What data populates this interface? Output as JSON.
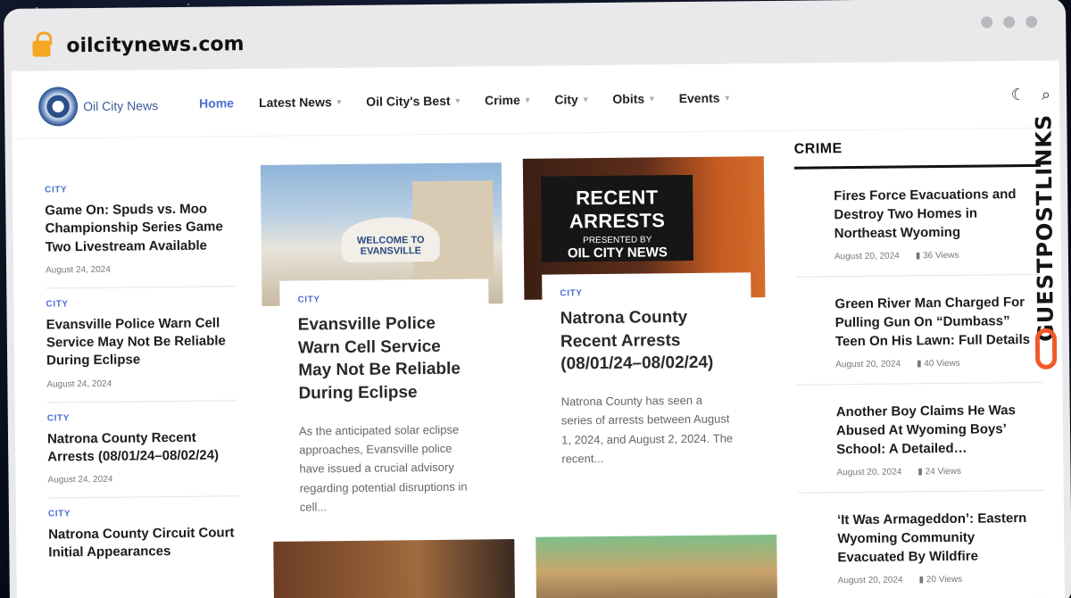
{
  "browser": {
    "url": "oilcitynews.com"
  },
  "site": {
    "logo_text": "Oil City News"
  },
  "nav": {
    "items": [
      {
        "label": "Home",
        "active": true
      },
      {
        "label": "Latest News",
        "chevron": true
      },
      {
        "label": "Oil City's Best",
        "chevron": true
      },
      {
        "label": "Crime",
        "chevron": true
      },
      {
        "label": "City",
        "chevron": true
      },
      {
        "label": "Obits",
        "chevron": true
      },
      {
        "label": "Events",
        "chevron": true
      }
    ],
    "icons": [
      "moon-icon",
      "search-icon"
    ]
  },
  "left_list": [
    {
      "category": "CITY",
      "title": "Game On: Spuds vs. Moo Championship Series Game Two Livestream Available",
      "date": "August 24, 2024"
    },
    {
      "category": "CITY",
      "title": "Evansville Police Warn Cell Service May Not Be Reliable During Eclipse",
      "date": "August 24, 2024"
    },
    {
      "category": "CITY",
      "title": "Natrona County Recent Arrests (08/01/24–08/02/24)",
      "date": "August 24, 2024"
    },
    {
      "category": "CITY",
      "title": "Natrona County Circuit Court Initial Appearances",
      "date": ""
    }
  ],
  "cards": [
    {
      "category": "CITY",
      "title": "Evansville Police Warn Cell Service May Not Be Reliable During Eclipse",
      "excerpt": "As the anticipated solar eclipse approaches, Evansville police have issued a crucial advisory regarding potential disruptions in cell...",
      "image_text": "WELCOME TO EVANSVILLE"
    },
    {
      "category": "CITY",
      "title": "Natrona County Recent Arrests (08/01/24–08/02/24)",
      "excerpt": "Natrona County has seen a series of arrests between August 1, 2024, and August 2, 2024. The recent...",
      "image_text": {
        "line1": "RECENT ARRESTS",
        "line2": "PRESENTED BY",
        "line3": "OIL CITY NEWS"
      }
    }
  ],
  "right_column": {
    "heading": "CRIME",
    "items": [
      {
        "title": "Fires Force Evacuations and Destroy Two Homes in Northeast Wyoming",
        "date": "August 20, 2024",
        "views": "36 Views"
      },
      {
        "title": "Green River Man Charged For Pulling Gun On “Dumbass” Teen On His Lawn: Full Details",
        "date": "August 20, 2024",
        "views": "40 Views"
      },
      {
        "title": "Another Boy Claims He Was Abused At Wyoming Boys’ School: A Detailed…",
        "date": "August 20, 2024",
        "views": "24 Views"
      },
      {
        "title": "‘It Was Armageddon’: Eastern Wyoming Community Evacuated By Wildfire",
        "date": "August 20, 2024",
        "views": "20 Views"
      }
    ]
  },
  "watermark": {
    "text": "GUESTPOSTLINKS"
  },
  "colors": {
    "accent": "#4a6fd1",
    "brand_orange": "#f05a28"
  }
}
